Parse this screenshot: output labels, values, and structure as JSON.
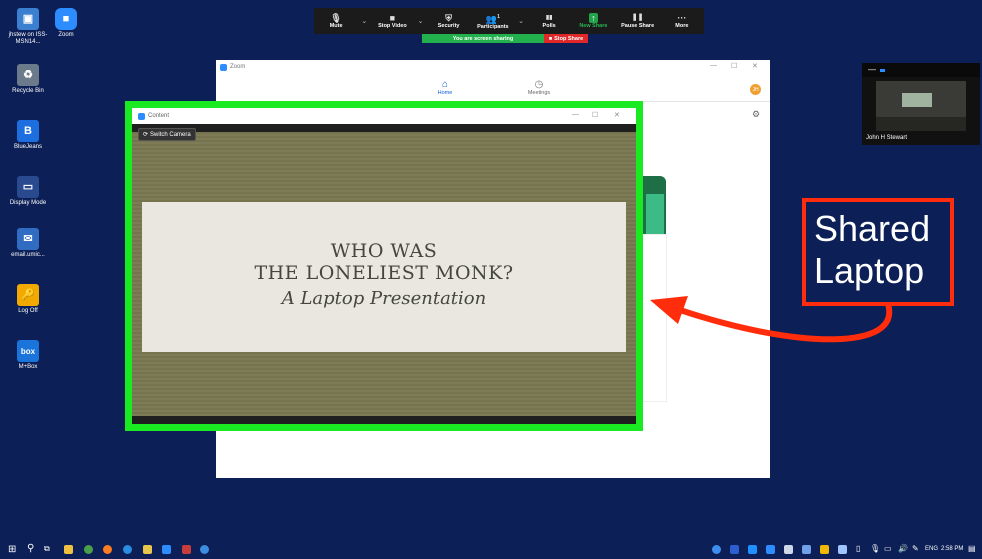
{
  "desktop_icons": [
    {
      "label": "jhstew on ISS-MSN14...",
      "color": "#3b7fd1",
      "glyph": "▣"
    },
    {
      "label": "Zoom",
      "color": "#2d8cff",
      "glyph": "■"
    },
    {
      "label": "Recycle Bin",
      "color": "#6b7b8c",
      "glyph": "♻"
    },
    {
      "label": "BlueJeans",
      "color": "#1d6fe0",
      "glyph": "B"
    },
    {
      "label": "Display Mode",
      "color": "#294a8f",
      "glyph": "▭"
    },
    {
      "label": "email.umic...",
      "color": "#2f6cc2",
      "glyph": "✉"
    },
    {
      "label": "Log Off",
      "color": "#f2a900",
      "glyph": "🔑"
    },
    {
      "label": "M+Box",
      "color": "#1b74d9",
      "glyph": "box"
    }
  ],
  "zoom_toolbar": {
    "buttons": [
      {
        "label": "Mute",
        "icon": "microphone-icon",
        "glyph": "🎙"
      },
      {
        "label": "Stop Video",
        "icon": "video-camera-icon",
        "glyph": "■"
      },
      {
        "label": "Security",
        "icon": "shield-icon",
        "glyph": "⛨"
      },
      {
        "label": "Participants",
        "icon": "participants-icon",
        "glyph": "👥",
        "badge": "1"
      },
      {
        "label": "Polls",
        "icon": "polls-icon",
        "glyph": "▮▮"
      },
      {
        "label": "New Share",
        "icon": "share-icon",
        "glyph": "↑"
      },
      {
        "label": "Pause Share",
        "icon": "pause-icon",
        "glyph": "❚❚"
      },
      {
        "label": "More",
        "icon": "more-icon",
        "glyph": "···"
      }
    ],
    "sharing_status": "You are screen sharing",
    "stop_share_label": "Stop Share"
  },
  "zoom_window": {
    "title": "Zoom",
    "tabs": [
      {
        "label": "Home",
        "icon": "home-icon",
        "glyph": "⌂",
        "active": true
      },
      {
        "label": "Meetings",
        "icon": "clock-icon",
        "glyph": "◷",
        "active": false
      }
    ],
    "avatar_initials": "JH"
  },
  "content_window": {
    "title": "Content",
    "switch_camera_label": "Switch Camera",
    "slide": {
      "line1": "WHO WAS",
      "line2": "THE LONELIEST MONK?",
      "subtitle": "A Laptop Presentation"
    }
  },
  "video_thumbnail": {
    "participant_name": "John H Stewart"
  },
  "callout": {
    "line1": "Shared",
    "line2": "Laptop",
    "color": "#ff2d0b"
  },
  "taskbar": {
    "language": "ENG",
    "time": "2:58 PM"
  }
}
